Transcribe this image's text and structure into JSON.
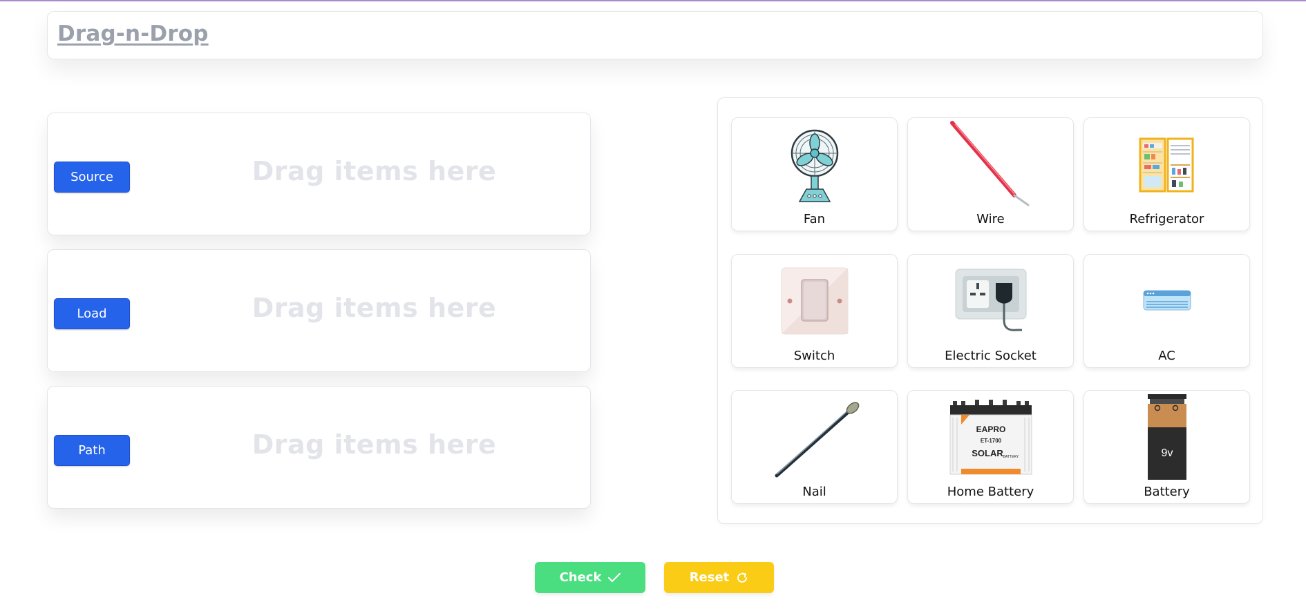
{
  "header": {
    "title": "Drag-n-Drop"
  },
  "zones": [
    {
      "label": "Source",
      "placeholder": "Drag items here"
    },
    {
      "label": "Load",
      "placeholder": "Drag items here"
    },
    {
      "label": "Path",
      "placeholder": "Drag items here"
    }
  ],
  "items": [
    {
      "label": "Fan",
      "icon": "fan-icon"
    },
    {
      "label": "Wire",
      "icon": "wire-icon"
    },
    {
      "label": "Refrigerator",
      "icon": "refrigerator-icon"
    },
    {
      "label": "Switch",
      "icon": "switch-icon"
    },
    {
      "label": "Electric Socket",
      "icon": "socket-icon"
    },
    {
      "label": "AC",
      "icon": "ac-icon"
    },
    {
      "label": "Nail",
      "icon": "nail-icon"
    },
    {
      "label": "Home Battery",
      "icon": "home-battery-icon",
      "image_text": [
        "EAPRO",
        "ET-1700",
        "SOLAR",
        "BATTERY"
      ]
    },
    {
      "label": "Battery",
      "icon": "battery-icon",
      "image_text": "9v"
    }
  ],
  "buttons": {
    "check": "Check",
    "reset": "Reset"
  },
  "colors": {
    "primary": "#2563eb",
    "check": "#4ade80",
    "reset": "#facc15",
    "title": "#9aa0ac"
  }
}
